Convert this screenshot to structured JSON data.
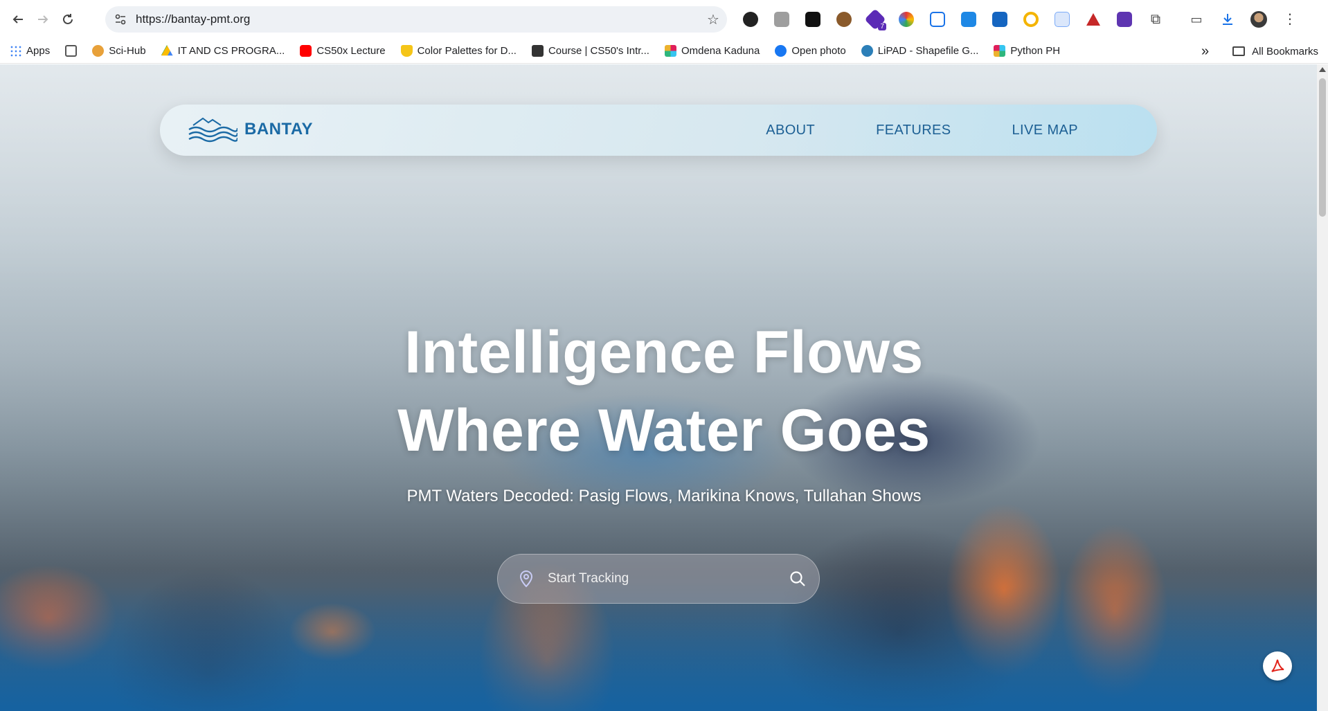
{
  "browser": {
    "url": "https://bantay-pmt.org",
    "back_icon": "arrow-left-icon",
    "forward_icon": "arrow-right-icon",
    "reload_icon": "reload-icon",
    "extensions": [
      {
        "name": "ext-1",
        "color": "#222222"
      },
      {
        "name": "ext-camera",
        "color": "#9e9e9e"
      },
      {
        "name": "ext-f",
        "color": "#111111"
      },
      {
        "name": "ext-owl",
        "color": "#8a5a2b"
      },
      {
        "name": "ext-badge",
        "color": "#5b2bb6",
        "badge": "7"
      },
      {
        "name": "ext-colors",
        "color": "#e53935"
      },
      {
        "name": "ext-crop",
        "color": "#1a73e8"
      },
      {
        "name": "ext-square",
        "color": "#1e88e5"
      },
      {
        "name": "ext-gear",
        "color": "#1565c0"
      },
      {
        "name": "ext-ring",
        "color": "#f4b400"
      },
      {
        "name": "ext-calendar",
        "color": "#7baaf7"
      },
      {
        "name": "ext-triangle",
        "color": "#c62828"
      },
      {
        "name": "ext-purple",
        "color": "#5e35b1"
      },
      {
        "name": "ext-puzzle",
        "color": "#444444"
      }
    ]
  },
  "bookmarks": {
    "items": [
      {
        "label": "Apps",
        "color": "#4285f4"
      },
      {
        "label": "",
        "color": "#555555"
      },
      {
        "label": "Sci-Hub",
        "color": "#e8a13a"
      },
      {
        "label": "IT AND CS PROGRA...",
        "color": "#34a853"
      },
      {
        "label": "CS50x Lecture",
        "color": "#ff0000"
      },
      {
        "label": "Color Palettes for D...",
        "color": "#f5c518"
      },
      {
        "label": "Course | CS50's Intr...",
        "color": "#333333"
      },
      {
        "label": "Omdena Kaduna",
        "color": "#e01e5a"
      },
      {
        "label": "Open photo",
        "color": "#1877f2"
      },
      {
        "label": "LiPAD - Shapefile G...",
        "color": "#2c7fb8"
      },
      {
        "label": "Python PH",
        "color": "#36c5f0"
      }
    ],
    "more": "»",
    "all_bookmarks": "All Bookmarks"
  },
  "site": {
    "brand": "BANTAY",
    "nav": [
      "ABOUT",
      "FEATURES",
      "LIVE MAP"
    ],
    "headline_line1": "Intelligence Flows",
    "headline_line2": "Where Water Goes",
    "subline": "PMT Waters Decoded: Pasig Flows, Marikina Knows, Tullahan Shows",
    "search_placeholder": "Start Tracking"
  },
  "colors": {
    "brand": "#1b6aa5",
    "nav_link": "#1c5f94"
  }
}
